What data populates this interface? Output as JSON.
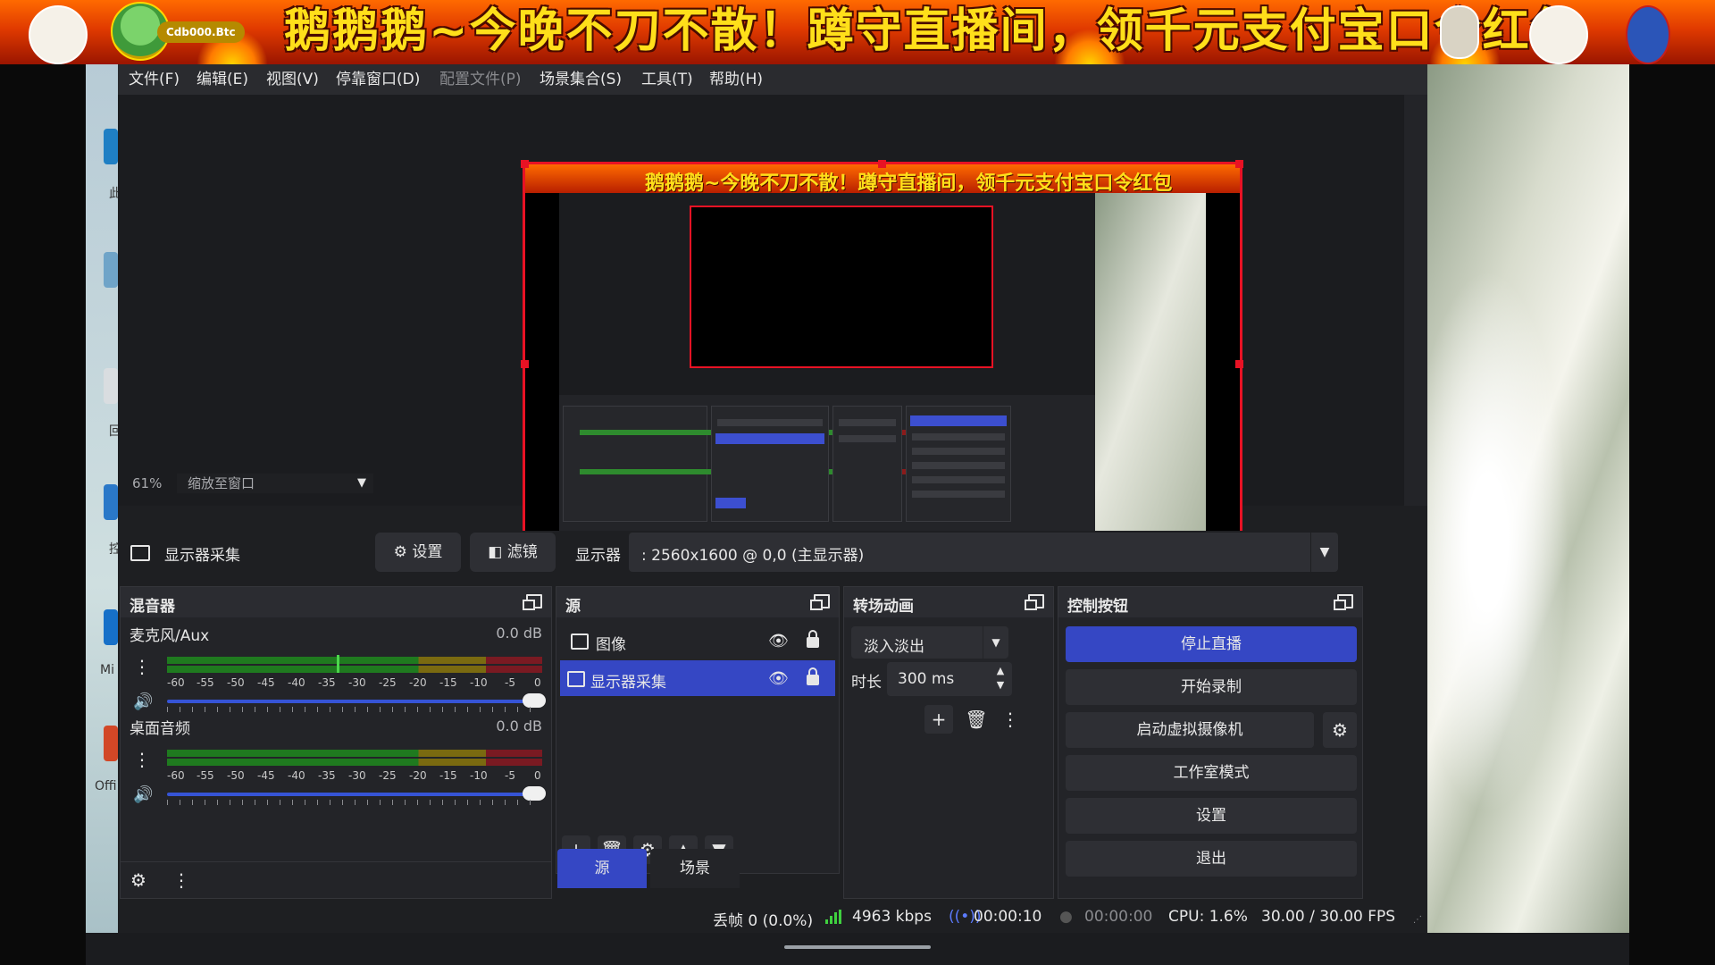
{
  "banner": {
    "text": "鹅鹅鹅~今晚不刀不散！蹲守直播间，领千元支付宝口令红包",
    "channel_chip": "Cdb000.Btc"
  },
  "menu": [
    {
      "label": "文件(F)",
      "enabled": true
    },
    {
      "label": "编辑(E)",
      "enabled": true
    },
    {
      "label": "视图(V)",
      "enabled": true
    },
    {
      "label": "停靠窗口(D)",
      "enabled": true
    },
    {
      "label": "配置文件(P)",
      "enabled": false
    },
    {
      "label": "场景集合(S)",
      "enabled": true
    },
    {
      "label": "工具(T)",
      "enabled": true
    },
    {
      "label": "帮助(H)",
      "enabled": true
    }
  ],
  "desktop_labels": [
    "此",
    "回",
    "控",
    "Mi",
    "Offi"
  ],
  "preview": {
    "zoom_percent": "61%",
    "zoom_mode": "缩放至窗口"
  },
  "properties": {
    "source_name": "显示器采集",
    "settings_label": "设置",
    "filters_label": "滤镜",
    "display_label": "显示器",
    "display_value": ": 2560x1600 @ 0,0 (主显示器)"
  },
  "mixer": {
    "title": "混音器",
    "ticks": [
      "-60",
      "-55",
      "-50",
      "-45",
      "-40",
      "-35",
      "-30",
      "-25",
      "-20",
      "-15",
      "-10",
      "-5",
      "0"
    ],
    "channels": [
      {
        "name": "麦克风/Aux",
        "db": "0.0 dB",
        "volume_fraction": 1.0
      },
      {
        "name": "桌面音频",
        "db": "0.0 dB",
        "volume_fraction": 1.0
      }
    ]
  },
  "sources": {
    "title": "源",
    "items": [
      {
        "label": "图像",
        "selected": false,
        "icon": "image-icon"
      },
      {
        "label": "显示器采集",
        "selected": true,
        "icon": "monitor-icon"
      }
    ],
    "tabs": [
      {
        "label": "源",
        "active": true
      },
      {
        "label": "场景",
        "active": false
      }
    ]
  },
  "transitions": {
    "title": "转场动画",
    "selected": "淡入淡出",
    "duration_label": "时长",
    "duration_value": "300 ms"
  },
  "controls": {
    "title": "控制按钮",
    "stop_stream": "停止直播",
    "start_record": "开始录制",
    "virtual_cam": "启动虚拟摄像机",
    "studio_mode": "工作室模式",
    "settings": "设置",
    "exit": "退出"
  },
  "status": {
    "dropped": "丢帧 0 (0.0%)",
    "bitrate": "4963 kbps",
    "stream_time": "00:00:10",
    "record_time": "00:00:00",
    "cpu": "CPU: 1.6%",
    "fps": "30.00 / 30.00 FPS"
  },
  "colors": {
    "accent": "#3547c4",
    "selection_border": "#e81224",
    "meter_green": "#1f7a1f",
    "meter_yellow": "#7a6a10",
    "meter_red": "#7a1a22",
    "banner_text": "#ffdf1a"
  }
}
